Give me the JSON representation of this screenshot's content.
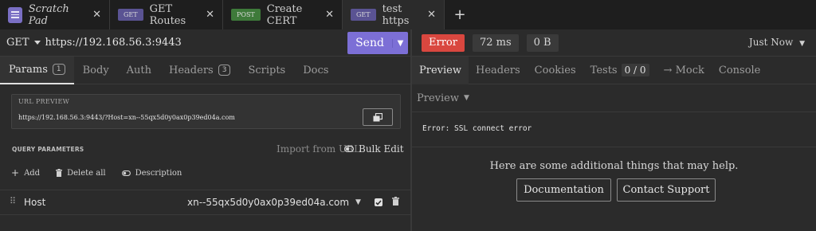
{
  "tabs": [
    {
      "label": "Scratch Pad",
      "method": ""
    },
    {
      "label": "GET Routes",
      "method": "GET"
    },
    {
      "label": "Create CERT",
      "method": "POST"
    },
    {
      "label": "test https",
      "method": "GET"
    }
  ],
  "close_glyph": "✕",
  "add_tab_glyph": "+",
  "request": {
    "method": "GET",
    "url": "https://192.168.56.3:9443",
    "send_label": "Send"
  },
  "response_status": {
    "status": "Error",
    "time": "72 ms",
    "size": "0 B",
    "when": "Just Now"
  },
  "request_tabs": {
    "params": "Params",
    "params_count": "1",
    "body": "Body",
    "auth": "Auth",
    "headers": "Headers",
    "headers_count": "3",
    "scripts": "Scripts",
    "docs": "Docs"
  },
  "url_preview": {
    "title": "URL PREVIEW",
    "url": "https://192.168.56.3:9443/?Host=xn--55qx5d0y0ax0p39ed04a.com"
  },
  "query_params": {
    "title": "QUERY PARAMETERS",
    "import_label": "Import from URL",
    "bulk_edit_label": "Bulk Edit",
    "add_label": "Add",
    "delete_all_label": "Delete all",
    "description_label": "Description",
    "rows": [
      {
        "name": "Host",
        "value": "xn--55qx5d0y0ax0p39ed04a.com",
        "enabled": true
      }
    ]
  },
  "response_tabs": {
    "preview": "Preview",
    "headers": "Headers",
    "cookies": "Cookies",
    "tests": "Tests",
    "tests_count": "0 / 0",
    "mock": "→ Mock",
    "console": "Console"
  },
  "response_body": {
    "preview_mode": "Preview",
    "error_text": "Error: SSL connect error",
    "help_text": "Here are some additional things that may help.",
    "documentation_label": "Documentation",
    "contact_label": "Contact Support"
  },
  "colors": {
    "accent": "#7c6fd6",
    "error": "#d9473f",
    "get_badge": "#5a5393",
    "post_badge": "#3e7a3a"
  }
}
